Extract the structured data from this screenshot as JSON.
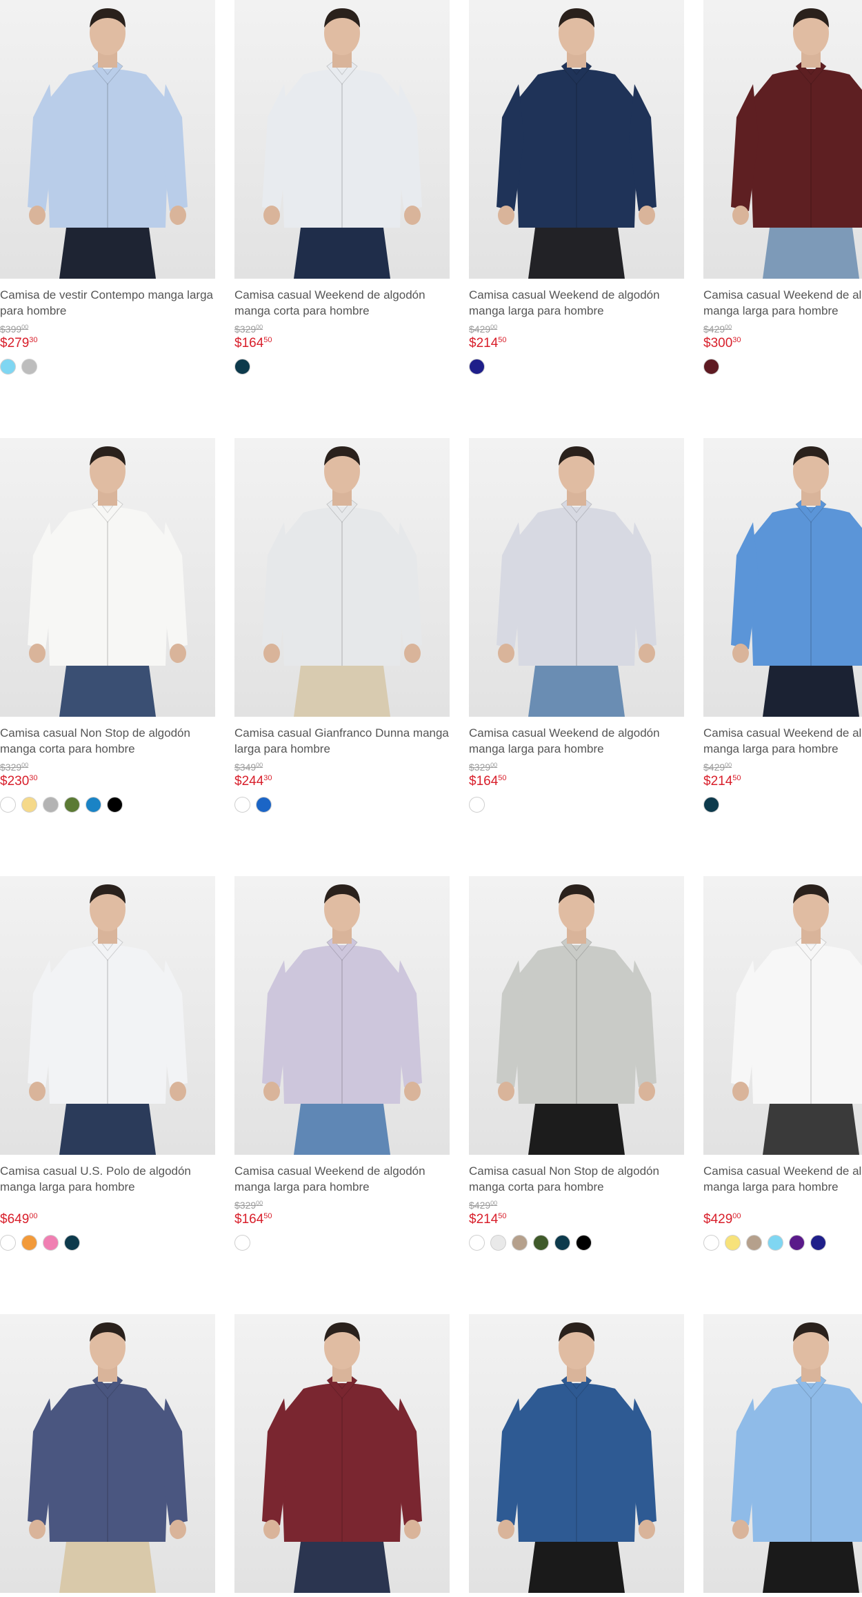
{
  "products": [
    {
      "title": "Camisa de vestir Contempo manga larga para hombre",
      "old_price": "$399",
      "old_cents": "00",
      "price": "$279",
      "cents": "30",
      "shirt_color": "#b9cde9",
      "pants_color": "#1e2433",
      "swatches": [
        "#7fd6f2",
        "#bdbdbd"
      ]
    },
    {
      "title": "Camisa casual Weekend de algodón manga corta para hombre",
      "old_price": "$329",
      "old_cents": "00",
      "price": "$164",
      "cents": "50",
      "shirt_color": "#e8ebef",
      "pants_color": "#1f2d4a",
      "swatches": [
        "#0d3a4c"
      ]
    },
    {
      "title": "Camisa casual Weekend de algodón manga larga para hombre",
      "old_price": "$429",
      "old_cents": "00",
      "price": "$214",
      "cents": "50",
      "shirt_color": "#1f3358",
      "pants_color": "#222226",
      "swatches": [
        "#1f1f8a"
      ]
    },
    {
      "title": "Camisa casual Weekend de algodón manga larga para hombre",
      "old_price": "$429",
      "old_cents": "00",
      "price": "$300",
      "cents": "30",
      "shirt_color": "#5e1f22",
      "pants_color": "#7d9ab8",
      "swatches": [
        "#5e1a22"
      ]
    },
    {
      "title": "Camisa casual Non Stop de algodón manga corta para hombre",
      "old_price": "$329",
      "old_cents": "00",
      "price": "$230",
      "cents": "30",
      "shirt_color": "#f7f7f5",
      "pants_color": "#3a4f73",
      "swatches": [
        "#ffffff",
        "#f5d98a",
        "#b3b3b3",
        "#5b7a34",
        "#1a83c5",
        "#000000"
      ]
    },
    {
      "title": "Camisa casual Gianfranco Dunna manga larga para hombre",
      "old_price": "$349",
      "old_cents": "00",
      "price": "$244",
      "cents": "30",
      "shirt_color": "#e6e8ea",
      "pants_color": "#d8cbb0",
      "swatches": [
        "#ffffff",
        "#1b65c6"
      ]
    },
    {
      "title": "Camisa casual Weekend de algodón manga larga para hombre",
      "old_price": "$329",
      "old_cents": "00",
      "price": "$164",
      "cents": "50",
      "shirt_color": "#d7d9e2",
      "pants_color": "#6a8db3",
      "swatches": [
        "#ffffff"
      ]
    },
    {
      "title": "Camisa casual Weekend de algodón manga larga para hombre",
      "old_price": "$429",
      "old_cents": "00",
      "price": "$214",
      "cents": "50",
      "shirt_color": "#5b95d8",
      "pants_color": "#1b2233",
      "swatches": [
        "#0d3a4c"
      ]
    },
    {
      "title": "Camisa casual U.S. Polo de algodón manga larga para hombre",
      "old_price": "",
      "old_cents": "",
      "price": "$649",
      "cents": "00",
      "shirt_color": "#f2f3f5",
      "pants_color": "#2b3b5a",
      "swatches": [
        "#ffffff",
        "#f29a3a",
        "#f07fb2",
        "#0d3a4c"
      ]
    },
    {
      "title": "Camisa casual Weekend de algodón manga larga para hombre",
      "old_price": "$329",
      "old_cents": "00",
      "price": "$164",
      "cents": "50",
      "shirt_color": "#cdc6dc",
      "pants_color": "#5f87b5",
      "swatches": [
        "#ffffff"
      ]
    },
    {
      "title": "Camisa casual Non Stop de algodón manga corta para hombre",
      "old_price": "$429",
      "old_cents": "00",
      "price": "$214",
      "cents": "50",
      "shirt_color": "#c9cbc7",
      "pants_color": "#1c1c1c",
      "swatches": [
        "#ffffff",
        "#e9e9e9",
        "#b5a08c",
        "#3f5a2a",
        "#0d3a4c",
        "#000000"
      ]
    },
    {
      "title": "Camisa casual Weekend de algodón manga larga para hombre",
      "old_price": "",
      "old_cents": "",
      "price": "$429",
      "cents": "00",
      "shirt_color": "#f7f7f7",
      "pants_color": "#3a3a3a",
      "swatches": [
        "#ffffff",
        "#f7e27a",
        "#b5a08c",
        "#7fd6f2",
        "#5a1a8a",
        "#1f1f8a"
      ]
    },
    {
      "title": "",
      "old_price": "",
      "old_cents": "",
      "price": "",
      "cents": "",
      "shirt_color": "#4a5680",
      "pants_color": "#d9c9aa",
      "swatches": []
    },
    {
      "title": "",
      "old_price": "",
      "old_cents": "",
      "price": "",
      "cents": "",
      "shirt_color": "#7a2630",
      "pants_color": "#2b3550",
      "swatches": []
    },
    {
      "title": "",
      "old_price": "",
      "old_cents": "",
      "price": "",
      "cents": "",
      "shirt_color": "#2e5a93",
      "pants_color": "#1a1a1a",
      "swatches": []
    },
    {
      "title": "",
      "old_price": "",
      "old_cents": "",
      "price": "",
      "cents": "",
      "shirt_color": "#8fbbe8",
      "pants_color": "#1a1a1a",
      "swatches": []
    }
  ]
}
